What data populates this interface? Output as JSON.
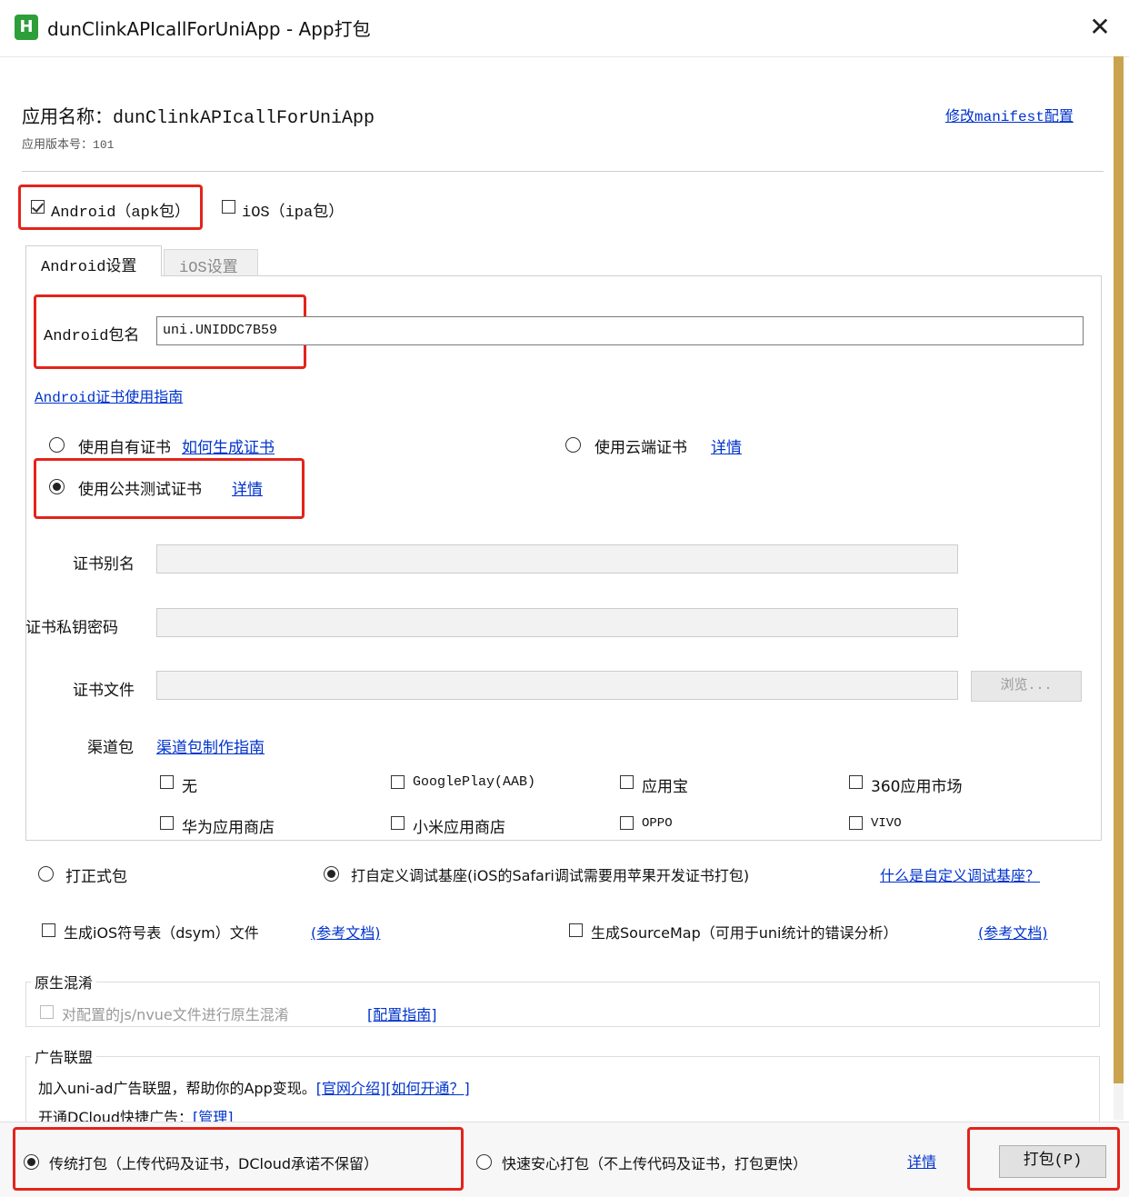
{
  "window": {
    "title": "dunClinkAPIcallForUniApp - App打包",
    "close_glyph": "✕",
    "icon_letter": "H",
    "icon": "hbuilder-icon"
  },
  "app_info": {
    "name_label": "应用名称：",
    "name_value": "dunClinkAPIcallForUniApp",
    "version_label": "应用版本号：",
    "version_value": "101",
    "manifest_link": "修改manifest配置"
  },
  "platforms": {
    "android": {
      "label": "Android（apk包）",
      "checked": true
    },
    "ios": {
      "label": "iOS（ipa包）",
      "checked": false
    }
  },
  "tabs": [
    {
      "label": "Android设置",
      "active": true
    },
    {
      "label": "iOS设置",
      "active": false
    }
  ],
  "android": {
    "package_label": "Android包名",
    "package_value": "uni.UNIDDC7B59",
    "cert_guide_link": "Android证书使用指南",
    "cert_options": {
      "own": {
        "label": "使用自有证书",
        "link": "如何生成证书",
        "checked": false
      },
      "cloud": {
        "label": "使用云端证书",
        "link": "详情",
        "checked": false
      },
      "public": {
        "label": "使用公共测试证书",
        "link": "详情",
        "checked": true
      }
    },
    "alias_label": "证书别名",
    "alias_value": "",
    "password_label": "证书私钥密码",
    "password_value": "",
    "file_label": "证书文件",
    "file_value": "",
    "browse_button": "浏览...",
    "channel_label": "渠道包",
    "channel_link": "渠道包制作指南",
    "channels": [
      {
        "label": "无",
        "checked": false
      },
      {
        "label": "GooglePlay(AAB)",
        "checked": false
      },
      {
        "label": "应用宝",
        "checked": false
      },
      {
        "label": "360应用市场",
        "checked": false
      },
      {
        "label": "华为应用商店",
        "checked": false
      },
      {
        "label": "小米应用商店",
        "checked": false
      },
      {
        "label": "OPPO",
        "checked": false
      },
      {
        "label": "VIVO",
        "checked": false
      }
    ]
  },
  "build_type": {
    "release": {
      "label": "打正式包",
      "checked": false
    },
    "custom_base": {
      "label": "打自定义调试基座(iOS的Safari调试需要用苹果开发证书打包)",
      "checked": true
    },
    "custom_base_link": "什么是自定义调试基座？"
  },
  "extras": {
    "dsym": {
      "label": "生成iOS符号表（dsym）文件",
      "link": "(参考文档)",
      "checked": false
    },
    "sourcemap": {
      "label": "生成SourceMap（可用于uni统计的错误分析）",
      "link": "(参考文档)",
      "checked": false
    }
  },
  "obfuscation": {
    "title": "原生混淆",
    "checkbox_label": "对配置的js/nvue文件进行原生混淆",
    "link": "[配置指南]"
  },
  "ads": {
    "title": "广告联盟",
    "line1_text": "加入uni-ad广告联盟，帮助你的App变现。",
    "line1_link1": "[官网介绍]",
    "line1_link2": "[如何开通？]",
    "line2_text": "开通DCloud快捷广告：",
    "line2_link": "[管理]"
  },
  "footer": {
    "traditional": {
      "label": "传统打包（上传代码及证书，DCloud承诺不保留）",
      "checked": true
    },
    "fast": {
      "label": "快速安心打包（不上传代码及证书，打包更快）",
      "checked": false
    },
    "fast_link": "详情",
    "pack_button": "打包(P)"
  },
  "colors": {
    "link": "#0033cc",
    "highlight": "#e3241b",
    "scroll_thumb": "#c9a34e"
  }
}
